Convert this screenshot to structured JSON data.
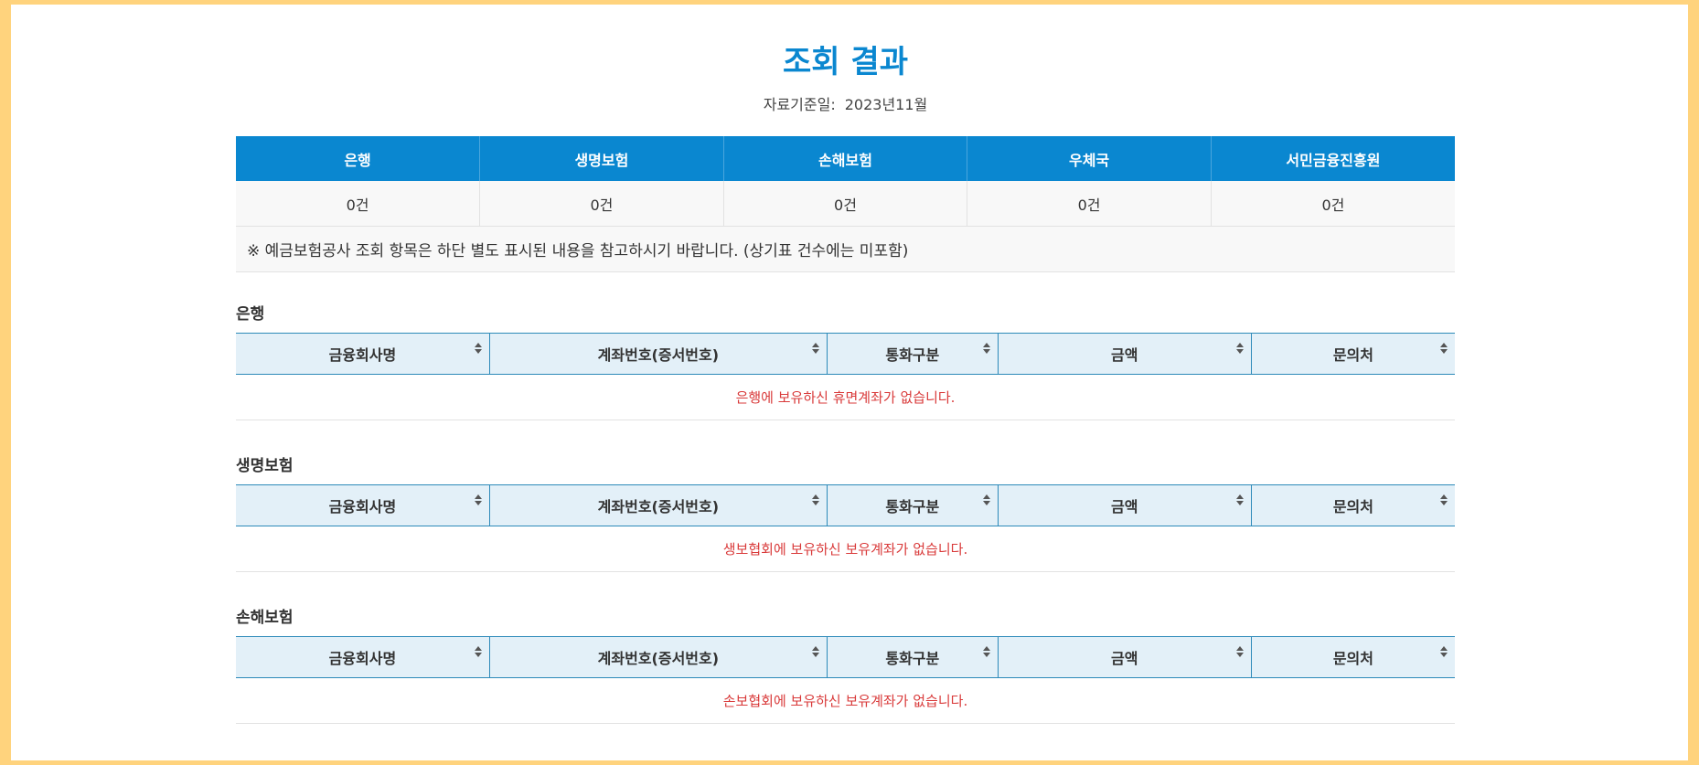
{
  "page": {
    "title": "조회 결과",
    "base_date_label": "자료기준일:",
    "base_date_value": "2023년11월"
  },
  "summary": {
    "headers": [
      "은행",
      "생명보험",
      "손해보험",
      "우체국",
      "서민금융진흥원"
    ],
    "counts": [
      "0건",
      "0건",
      "0건",
      "0건",
      "0건"
    ],
    "note": "※ 예금보험공사 조회 항목은 하단 별도 표시된 내용을 참고하시기 바랍니다. (상기표 건수에는 미포함)"
  },
  "columns": [
    "금융회사명",
    "계좌번호(증서번호)",
    "통화구분",
    "금액",
    "문의처"
  ],
  "sections": [
    {
      "title": "은행",
      "empty_message": "은행에 보유하신 휴면계좌가 없습니다."
    },
    {
      "title": "생명보험",
      "empty_message": "생보협회에 보유하신 보유계좌가 없습니다."
    },
    {
      "title": "손해보험",
      "empty_message": "손보협회에 보유하신 보유계좌가 없습니다."
    }
  ],
  "colors": {
    "accent": "#0a87d0",
    "header_bg": "#e3f0f8",
    "empty_text": "#d93a3a",
    "frame": "#ffd37d"
  },
  "icons": {
    "sort": "sort-arrows-icon"
  }
}
